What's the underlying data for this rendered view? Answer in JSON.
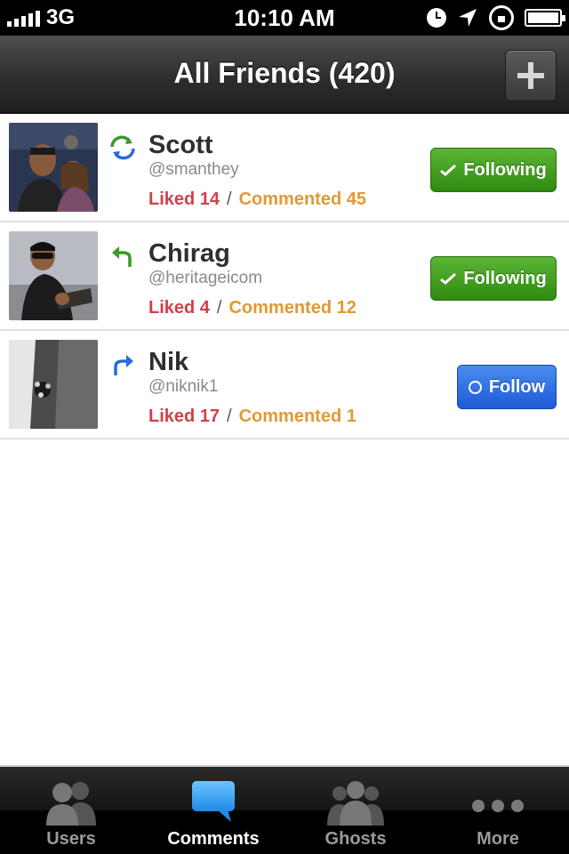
{
  "status_bar": {
    "carrier": "3G",
    "time": "10:10 AM"
  },
  "nav": {
    "title": "All Friends (420)",
    "add_icon": "plus-icon"
  },
  "friends": [
    {
      "name": "Scott",
      "handle": "@smanthey",
      "liked": "Liked 14",
      "separator": "/",
      "commented": "Commented 45",
      "button": "Following",
      "button_state": "following",
      "activity_icon": "sync-icon"
    },
    {
      "name": "Chirag",
      "handle": "@heritageicom",
      "liked": "Liked 4",
      "separator": "/",
      "commented": "Commented 12",
      "button": "Following",
      "button_state": "following",
      "activity_icon": "reply-arrow-icon"
    },
    {
      "name": "Nik",
      "handle": "@niknik1",
      "liked": "Liked 17",
      "separator": "/",
      "commented": "Commented 1",
      "button": "Follow",
      "button_state": "follow",
      "activity_icon": "forward-arrow-icon"
    }
  ],
  "tabs": [
    {
      "label": "Users",
      "icon": "users-icon",
      "active": false
    },
    {
      "label": "Comments",
      "icon": "comment-bubble-icon",
      "active": true
    },
    {
      "label": "Ghosts",
      "icon": "ghosts-icon",
      "active": false
    },
    {
      "label": "More",
      "icon": "more-dots-icon",
      "active": false
    }
  ],
  "colors": {
    "liked": "#d0414a",
    "commented": "#e09a33",
    "following_btn": "#3e9a1e",
    "follow_btn": "#2a6ae0"
  }
}
